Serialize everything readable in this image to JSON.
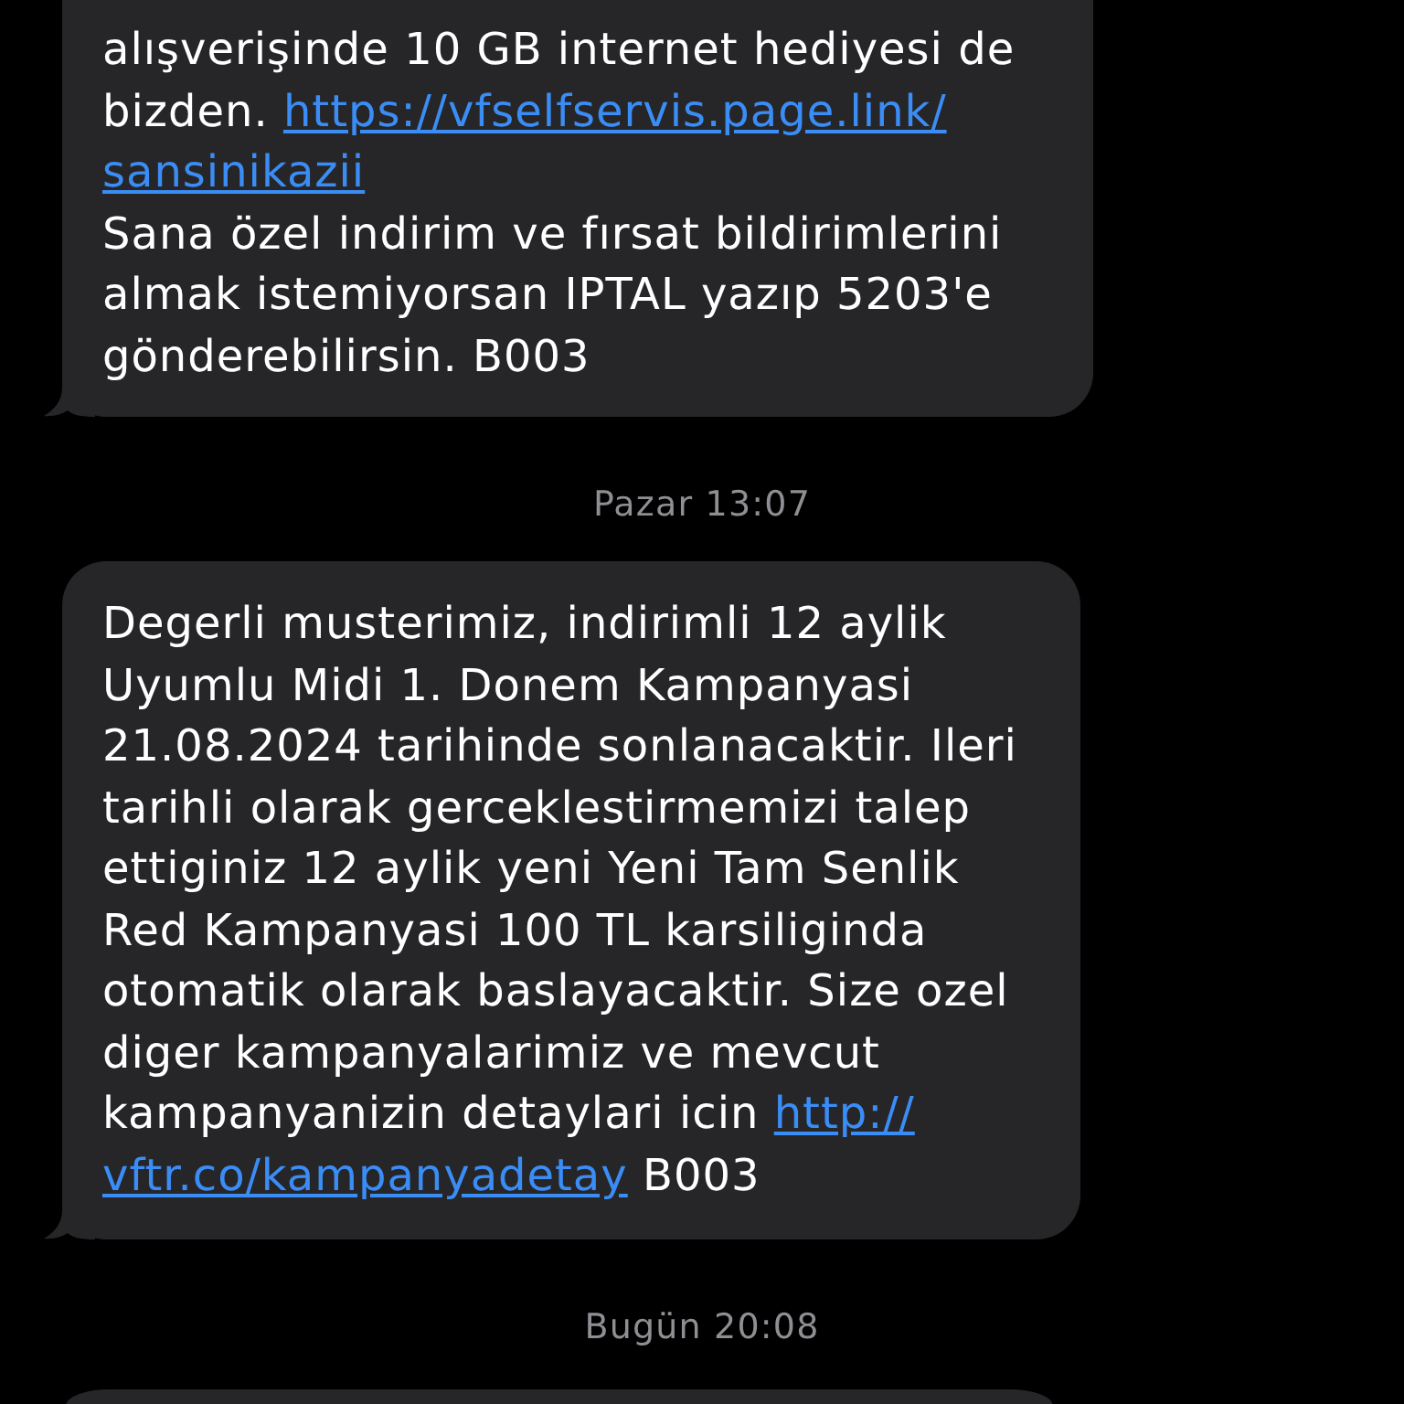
{
  "thread": [
    {
      "kind": "message",
      "tail": true,
      "paragraphs": [
        [
          {
            "kind": "text",
            "text": "alışverişinde 10 GB internet hediyesi de bizden. "
          },
          {
            "kind": "link",
            "text": "https://vfselfservis.page.link/"
          },
          {
            "kind": "link",
            "text": "sansinikazii"
          }
        ],
        [
          {
            "kind": "text",
            "text": "Sana özel indirim ve fırsat bildirimlerini almak istemiyorsan IPTAL yazıp 5203'e gönderebilirsin. B003"
          }
        ]
      ]
    },
    {
      "kind": "timestamp",
      "text": "Pazar 13:07"
    },
    {
      "kind": "message",
      "tail": true,
      "paragraphs": [
        [
          {
            "kind": "text",
            "text": "Degerli musterimiz, indirimli 12 aylik Uyumlu Midi 1. Donem Kampanyasi 21.08.2024 tarihinde sonlanacaktir. Ileri tarihli olarak gerceklestirmemizi talep ettiginiz 12 aylik yeni Yeni Tam Senlik Red Kampanyasi 100 TL karsiliginda otomatik olarak baslayacaktir. Size ozel diger kampanyalarimiz ve mevcut kampanyanizin detaylari icin "
          },
          {
            "kind": "link",
            "text": "http://"
          },
          {
            "kind": "link",
            "text": "vftr.co/kampanyadetay"
          },
          {
            "kind": "text",
            "text": " B003"
          }
        ]
      ]
    },
    {
      "kind": "timestamp",
      "text": "Bugün 20:08"
    },
    {
      "kind": "message",
      "tail": false
    }
  ]
}
